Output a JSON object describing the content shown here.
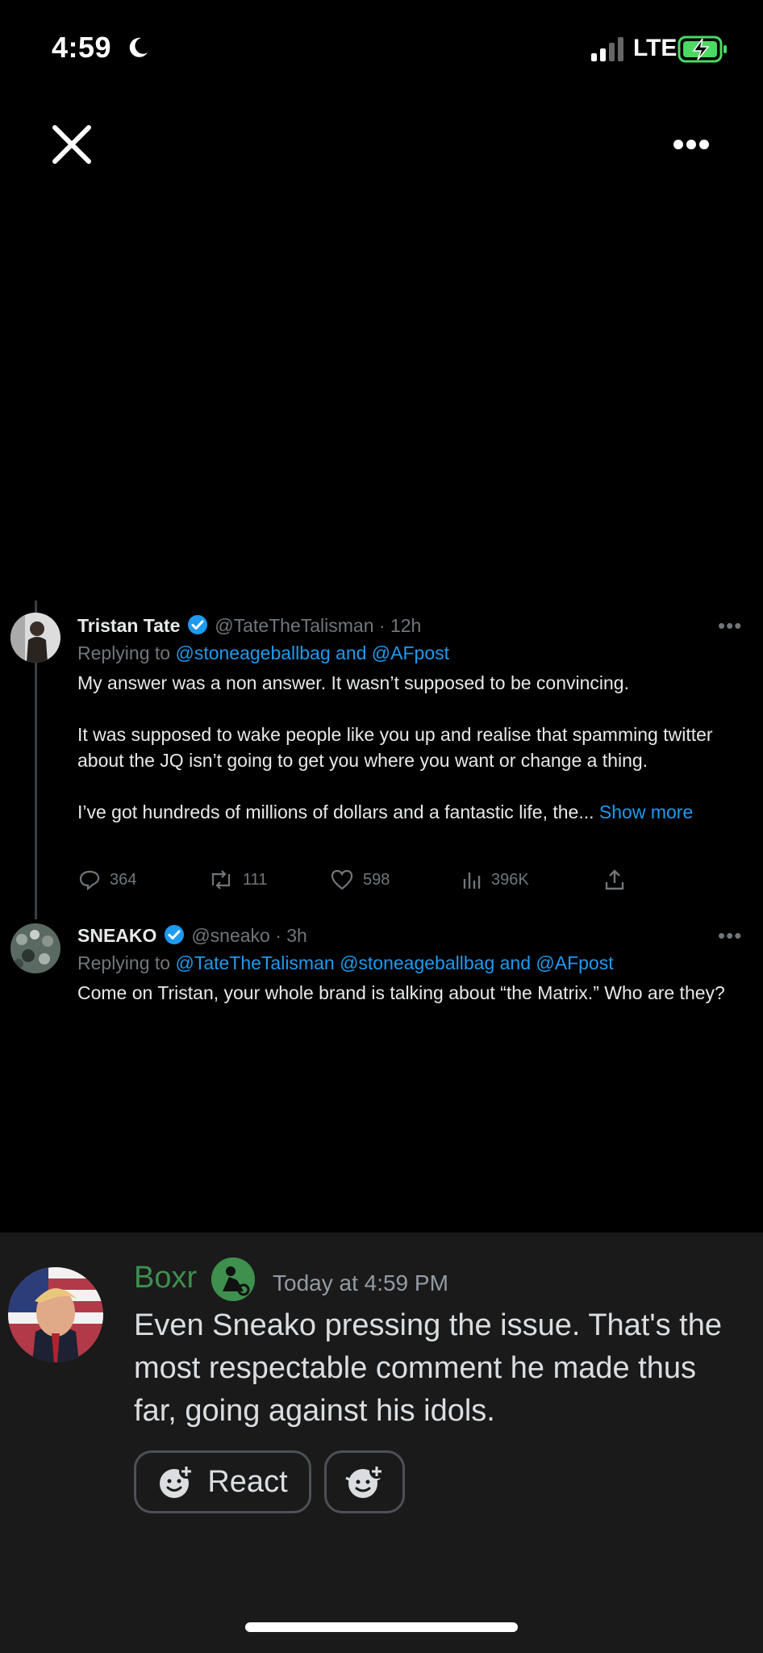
{
  "status_bar": {
    "time": "4:59",
    "network": "LTE",
    "icons": [
      "moon-icon",
      "signal-icon",
      "battery-charging-icon"
    ]
  },
  "viewer": {
    "close_icon": "close-icon",
    "more_icon": "more-icon"
  },
  "tweets": [
    {
      "name": "Tristan Tate",
      "handle": "@TateTheTalisman · 12h",
      "replying_prefix": "Replying to ",
      "replying_to": "@stoneageballbag and @AFpost",
      "body": [
        "My answer was a non answer. It wasn’t supposed to be convincing.",
        "It was supposed to wake people like you up and realise that spamming twitter about the JQ isn’t going to get you where you want or change a thing.",
        "I’ve got hundreds of millions of dollars and a fantastic life, the..."
      ],
      "show_more": "Show more",
      "stats": {
        "replies": "364",
        "retweets": "111",
        "likes": "598",
        "views": "396K"
      }
    },
    {
      "name": "SNEAKO",
      "handle": "@sneako · 3h",
      "replying_prefix": "Replying to ",
      "replying_to": "@TateTheTalisman @stoneageballbag and @AFpost",
      "body": [
        "Come on Tristan, your whole brand is talking about “the Matrix.” Who are they?"
      ]
    }
  ],
  "discord": {
    "author": "Boxr",
    "timestamp": "Today at 4:59 PM",
    "message": "Even Sneako pressing the issue. That's the most respectable comment he made thus far, going against his idols.",
    "react_label": "React",
    "colors": {
      "author": "#3f8f4e",
      "panel": "#1a1a1a"
    }
  },
  "colors": {
    "link": "#1d9bf0",
    "muted": "#71767b"
  }
}
